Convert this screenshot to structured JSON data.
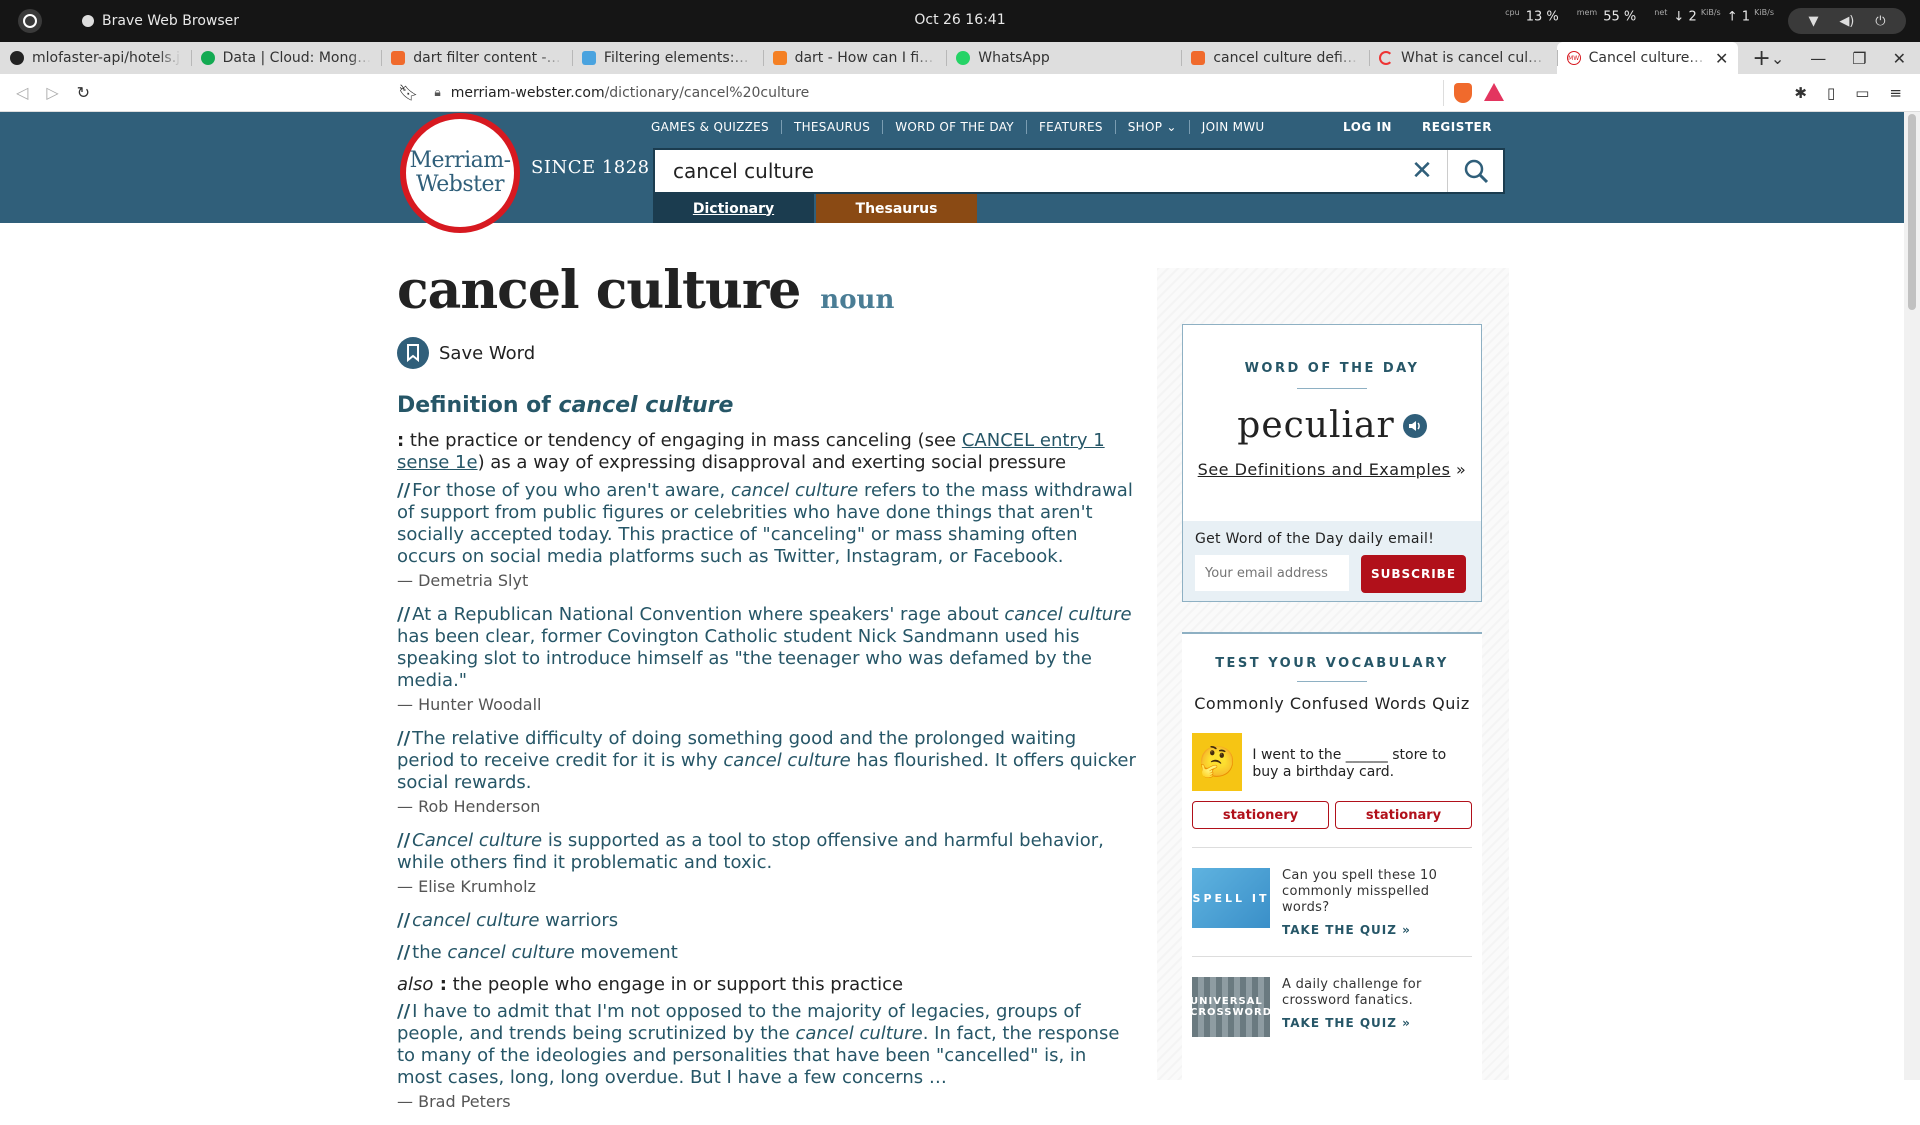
{
  "os": {
    "app_name": "Brave Web Browser",
    "clock": "Oct 26  16:41",
    "cpu_label": "cpu",
    "cpu_value": "13 %",
    "mem_label": "mem",
    "mem_value": "55 %",
    "net_label": "net",
    "net_down": "2",
    "net_up": "1",
    "net_unit": "KiB/s"
  },
  "tabs": [
    {
      "title": "mlofaster-api/hotels.j",
      "fav_color": "#222"
    },
    {
      "title": "Data | Cloud: MongoD",
      "fav_color": "#13aa52"
    },
    {
      "title": "dart filter content - Br",
      "fav_color": "#f06a2c"
    },
    {
      "title": "Filtering elements: wh",
      "fav_color": "#4aa3df"
    },
    {
      "title": "dart - How can I filter a",
      "fav_color": "#f48024"
    },
    {
      "title": "WhatsApp",
      "fav_color": "#25d366"
    },
    {
      "title": "cancel culture definiti",
      "fav_color": "#f06a2c"
    },
    {
      "title": "What is cancel culture",
      "fav_color": "#e33"
    },
    {
      "title": "Cancel culture Def",
      "fav_color": "#d71920",
      "active": true
    }
  ],
  "address": {
    "host": "merriam-webster.com",
    "path": "/dictionary/cancel%20culture"
  },
  "header": {
    "logo_line1": "Merriam-",
    "logo_line2": "Webster",
    "since": "SINCE 1828",
    "nav": [
      "GAMES & QUIZZES",
      "THESAURUS",
      "WORD OF THE DAY",
      "FEATURES",
      "SHOP",
      "JOIN MWU"
    ],
    "login": "LOG IN",
    "register": "REGISTER",
    "search_value": "cancel culture",
    "tab_dictionary": "Dictionary",
    "tab_thesaurus": "Thesaurus"
  },
  "entry": {
    "headword": "cancel culture",
    "pos": "noun",
    "save_word": "Save Word",
    "def_title_prefix": "Definition of ",
    "def_title_term": "cancel culture",
    "def_colon": ":",
    "def_text_a": " the practice or tendency of engaging in mass canceling (see ",
    "def_link": "CANCEL entry 1 sense 1e",
    "def_text_b": ") as a way of expressing disapproval and exerting social pressure",
    "examples": [
      {
        "pre": "For those of you who aren't aware, ",
        "term": "cancel culture",
        "post": " refers to the mass withdrawal of support from public figures or celebrities who have done things that aren't socially accepted today. This practice of \"canceling\" or mass shaming often occurs on social media platforms such as Twitter, Instagram, or Facebook.",
        "author": "— Demetria Slyt"
      },
      {
        "pre": "At a Republican National Convention where speakers' rage about ",
        "term": "cancel culture",
        "post": " has been clear, former Covington Catholic student Nick Sandmann used his speaking slot to introduce himself as \"the teenager who was defamed by the media.\"",
        "author": "— Hunter Woodall"
      },
      {
        "pre": "The relative difficulty of doing something good and the prolonged waiting period to receive credit for it is why ",
        "term": "cancel culture",
        "post": " has flourished. It offers quicker social rewards.",
        "author": "— Rob Henderson"
      },
      {
        "pre": "",
        "term": "Cancel culture",
        "post": " is supported as a tool to stop offensive and harmful behavior, while others find it problematic and toxic.",
        "author": "— Elise Krumholz"
      }
    ],
    "short_examples": [
      {
        "pre": "",
        "term": "cancel culture",
        "post": " warriors"
      },
      {
        "pre": "the ",
        "term": "cancel culture",
        "post": " movement"
      }
    ],
    "also_word": "also",
    "also_colon": " :",
    "also_text": " the people who engage in or support this practice",
    "also_example_pre": "I have to admit that I'm not opposed to the majority of legacies, groups of people, and trends being scrutinized by the ",
    "also_example_term": "cancel culture",
    "also_example_post": ". In fact, the response to many of the ideologies and personalities that have been \"cancelled\" is, in most cases, long, long overdue. But I have a few concerns …",
    "also_author": "— Brad Peters"
  },
  "sidebar": {
    "wod_label": "WORD OF THE DAY",
    "wod_word": "peculiar",
    "wod_link": "See Definitions and Examples",
    "wod_link_arrow": " »",
    "email_label": "Get Word of the Day daily email!",
    "email_placeholder": "Your email address",
    "subscribe": "SUBSCRIBE",
    "vocab_label": "TEST YOUR VOCABULARY",
    "vocab_title": "Commonly Confused Words Quiz",
    "quiz_question": "I went to the ______ store to buy a birthday card.",
    "choice_a": "stationery",
    "choice_b": "stationary",
    "promo1_img": "SPELL IT",
    "promo1_text": "Can you spell these 10 commonly misspelled words?",
    "promo1_cta": "TAKE THE QUIZ »",
    "promo2_img": "UNIVERSAL CROSSWORD",
    "promo2_text": "A daily challenge for crossword fanatics.",
    "promo2_cta": "TAKE THE QUIZ »"
  },
  "colors": {
    "mw_blue": "#305f7a",
    "mw_red": "#d71920",
    "thesaurus_orange": "#8a4a14",
    "subscribe_red": "#b1101a"
  }
}
